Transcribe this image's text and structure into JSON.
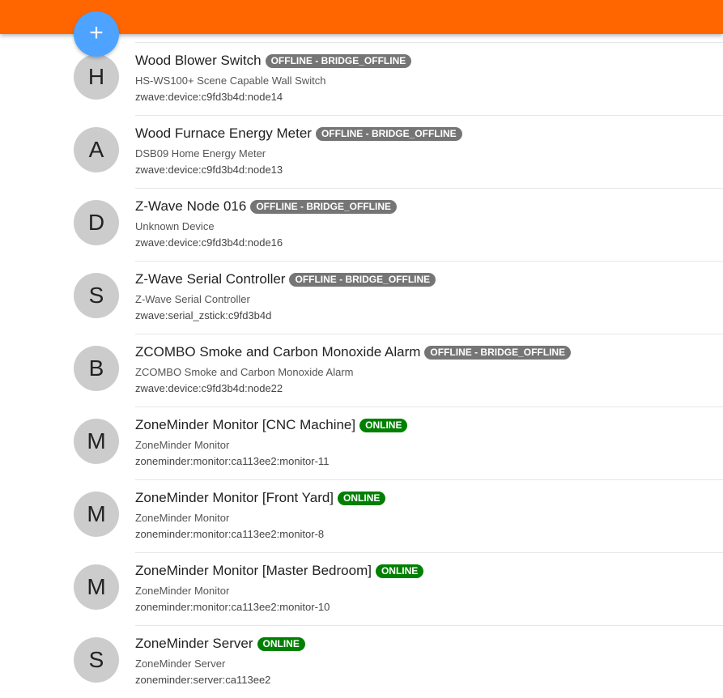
{
  "fab_label": "+",
  "colors": {
    "header": "#ff6600",
    "fab": "#4da3ff",
    "offline": "#757575",
    "online": "#008000"
  },
  "things": [
    {
      "avatar": "H",
      "name": "Wood Blower Switch",
      "status": "OFFLINE - BRIDGE_OFFLINE",
      "online": false,
      "type": "HS-WS100+ Scene Capable Wall Switch",
      "uid": "zwave:device:c9fd3b4d:node14"
    },
    {
      "avatar": "A",
      "name": "Wood Furnace Energy Meter",
      "status": "OFFLINE - BRIDGE_OFFLINE",
      "online": false,
      "type": "DSB09 Home Energy Meter",
      "uid": "zwave:device:c9fd3b4d:node13"
    },
    {
      "avatar": "D",
      "name": "Z-Wave Node 016",
      "status": "OFFLINE - BRIDGE_OFFLINE",
      "online": false,
      "type": "Unknown Device",
      "uid": "zwave:device:c9fd3b4d:node16"
    },
    {
      "avatar": "S",
      "name": "Z-Wave Serial Controller",
      "status": "OFFLINE - BRIDGE_OFFLINE",
      "online": false,
      "type": "Z-Wave Serial Controller",
      "uid": "zwave:serial_zstick:c9fd3b4d"
    },
    {
      "avatar": "B",
      "name": "ZCOMBO Smoke and Carbon Monoxide Alarm",
      "status": "OFFLINE - BRIDGE_OFFLINE",
      "online": false,
      "type": "ZCOMBO Smoke and Carbon Monoxide Alarm",
      "uid": "zwave:device:c9fd3b4d:node22"
    },
    {
      "avatar": "M",
      "name": "ZoneMinder Monitor [CNC Machine]",
      "status": "ONLINE",
      "online": true,
      "type": "ZoneMinder Monitor",
      "uid": "zoneminder:monitor:ca113ee2:monitor-11"
    },
    {
      "avatar": "M",
      "name": "ZoneMinder Monitor [Front Yard]",
      "status": "ONLINE",
      "online": true,
      "type": "ZoneMinder Monitor",
      "uid": "zoneminder:monitor:ca113ee2:monitor-8"
    },
    {
      "avatar": "M",
      "name": "ZoneMinder Monitor [Master Bedroom]",
      "status": "ONLINE",
      "online": true,
      "type": "ZoneMinder Monitor",
      "uid": "zoneminder:monitor:ca113ee2:monitor-10"
    },
    {
      "avatar": "S",
      "name": "ZoneMinder Server",
      "status": "ONLINE",
      "online": true,
      "type": "ZoneMinder Server",
      "uid": "zoneminder:server:ca113ee2"
    }
  ]
}
